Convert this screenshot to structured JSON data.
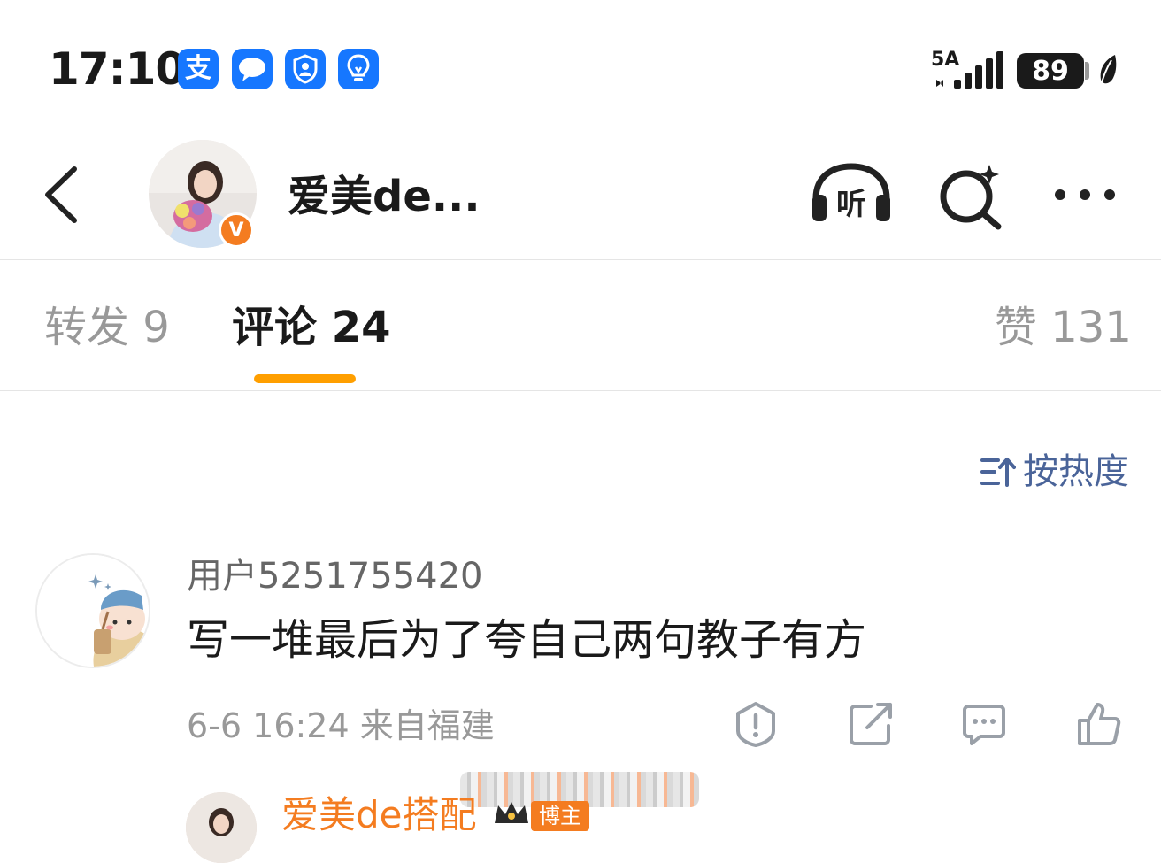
{
  "status_bar": {
    "time": "17:10",
    "app_icons": [
      "alipay-icon",
      "message-icon",
      "shield-icon",
      "bulb-icon"
    ],
    "alipay_glyph": "支",
    "network": "5A",
    "battery": "89"
  },
  "header": {
    "title": "爱美de...",
    "verified_badge": "V"
  },
  "tabs": {
    "repost": "转发 9",
    "comment": "评论 24",
    "like": "赞 131"
  },
  "sort": {
    "label": "按热度"
  },
  "comment": {
    "username": "用户5251755420",
    "text": "写一堆最后为了夸自己两句教子有方",
    "meta": "6-6 16:24 来自福建"
  },
  "reply_preview": {
    "username": "爱美de搭配",
    "tag": "博主"
  },
  "colors": {
    "accent": "#ff9f00",
    "verified": "#f47c20",
    "link_blue": "#4a6499",
    "app_blue": "#1677ff"
  }
}
